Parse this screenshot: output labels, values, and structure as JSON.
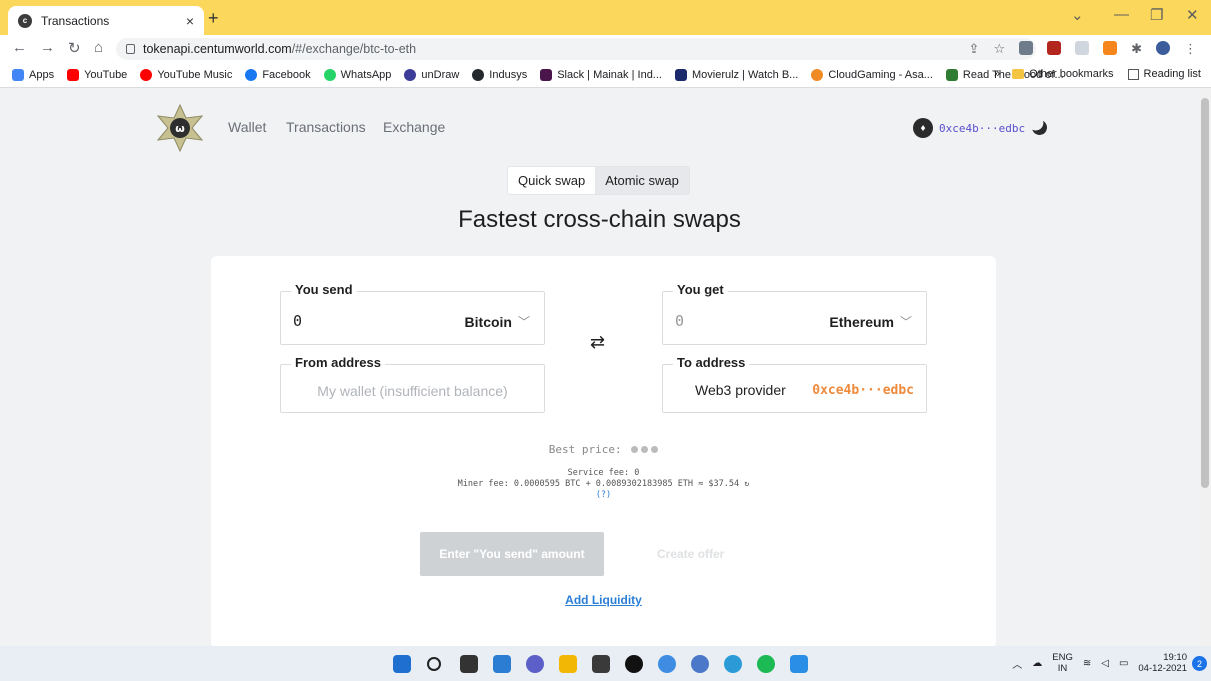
{
  "browser": {
    "tab_title": "Transactions",
    "tab_close": "×",
    "new_tab": "+",
    "url_host": "tokenapi.centumworld.com",
    "url_path": "/#/exchange/btc-to-eth",
    "bookmarks": [
      {
        "label": "Apps",
        "color": "#4285f4"
      },
      {
        "label": "YouTube",
        "color": "#ff0000"
      },
      {
        "label": "YouTube Music",
        "color": "#ff0000"
      },
      {
        "label": "Facebook",
        "color": "#1877f2"
      },
      {
        "label": "WhatsApp",
        "color": "#25d366"
      },
      {
        "label": "unDraw",
        "color": "#3b3b98"
      },
      {
        "label": "Indusys",
        "color": "#24292e"
      },
      {
        "label": "Slack | Mainak | Ind...",
        "color": "#4a154b"
      },
      {
        "label": "Movierulz | Watch B...",
        "color": "#1b2a6b"
      },
      {
        "label": "CloudGaming - Asa...",
        "color": "#f08a24"
      },
      {
        "label": "Read The Blood of...",
        "color": "#2e7d32"
      }
    ],
    "bookmarks_more": "»",
    "other_bookmarks": "Other bookmarks",
    "reading_list": "Reading list"
  },
  "header": {
    "nav": [
      "Wallet",
      "Transactions",
      "Exchange"
    ],
    "account_address": "0xce4b···edbc"
  },
  "swap_tabs": [
    "Quick swap",
    "Atomic swap"
  ],
  "headline": "Fastest cross-chain swaps",
  "form": {
    "send_label": "You send",
    "send_value": "0",
    "send_currency": "Bitcoin",
    "get_label": "You get",
    "get_value": "0",
    "get_currency": "Ethereum",
    "from_label": "From address",
    "from_placeholder": "My wallet (insufficient balance)",
    "to_label": "To address",
    "to_provider": "Web3 provider",
    "to_address": "0xce4b···edbc"
  },
  "pricing": {
    "best_price_label": "Best price:",
    "service_fee": "Service fee: 0",
    "miner_fee": "Miner fee: 0.0000595 BTC + 0.0089302183985 ETH ≈ $37.54",
    "help": "(?)"
  },
  "actions": {
    "enter_amount": "Enter \"You send\" amount",
    "create_offer": "Create offer",
    "add_liquidity": "Add Liquidity"
  },
  "taskbar": {
    "lang_top": "ENG",
    "lang_bottom": "IN",
    "time": "19:10",
    "date": "04-12-2021",
    "notifications": "2"
  }
}
